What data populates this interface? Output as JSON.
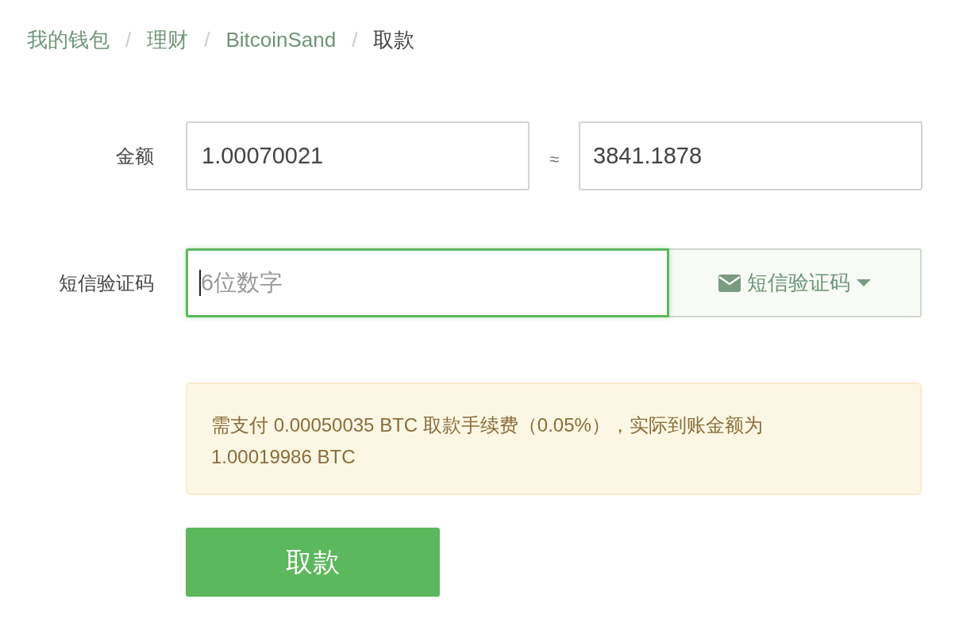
{
  "breadcrumb": [
    {
      "label": "我的钱包",
      "selected": false
    },
    {
      "label": "理财",
      "selected": false
    },
    {
      "label": "BitcoinSand",
      "selected": false
    },
    {
      "label": "取款",
      "selected": true
    }
  ],
  "breadcrumb_separator": "/",
  "amount": {
    "label": "金额",
    "value": "1.00070021",
    "approx": "≈",
    "converted": "3841.1878"
  },
  "sms": {
    "label": "短信验证码",
    "placeholder": "6位数字",
    "focused": true,
    "button": "短信验证码"
  },
  "notice": "需支付 0.00050035 BTC 取款手续费（0.05%），实际到账金额为 1.00019986 BTC",
  "submit": "取款"
}
